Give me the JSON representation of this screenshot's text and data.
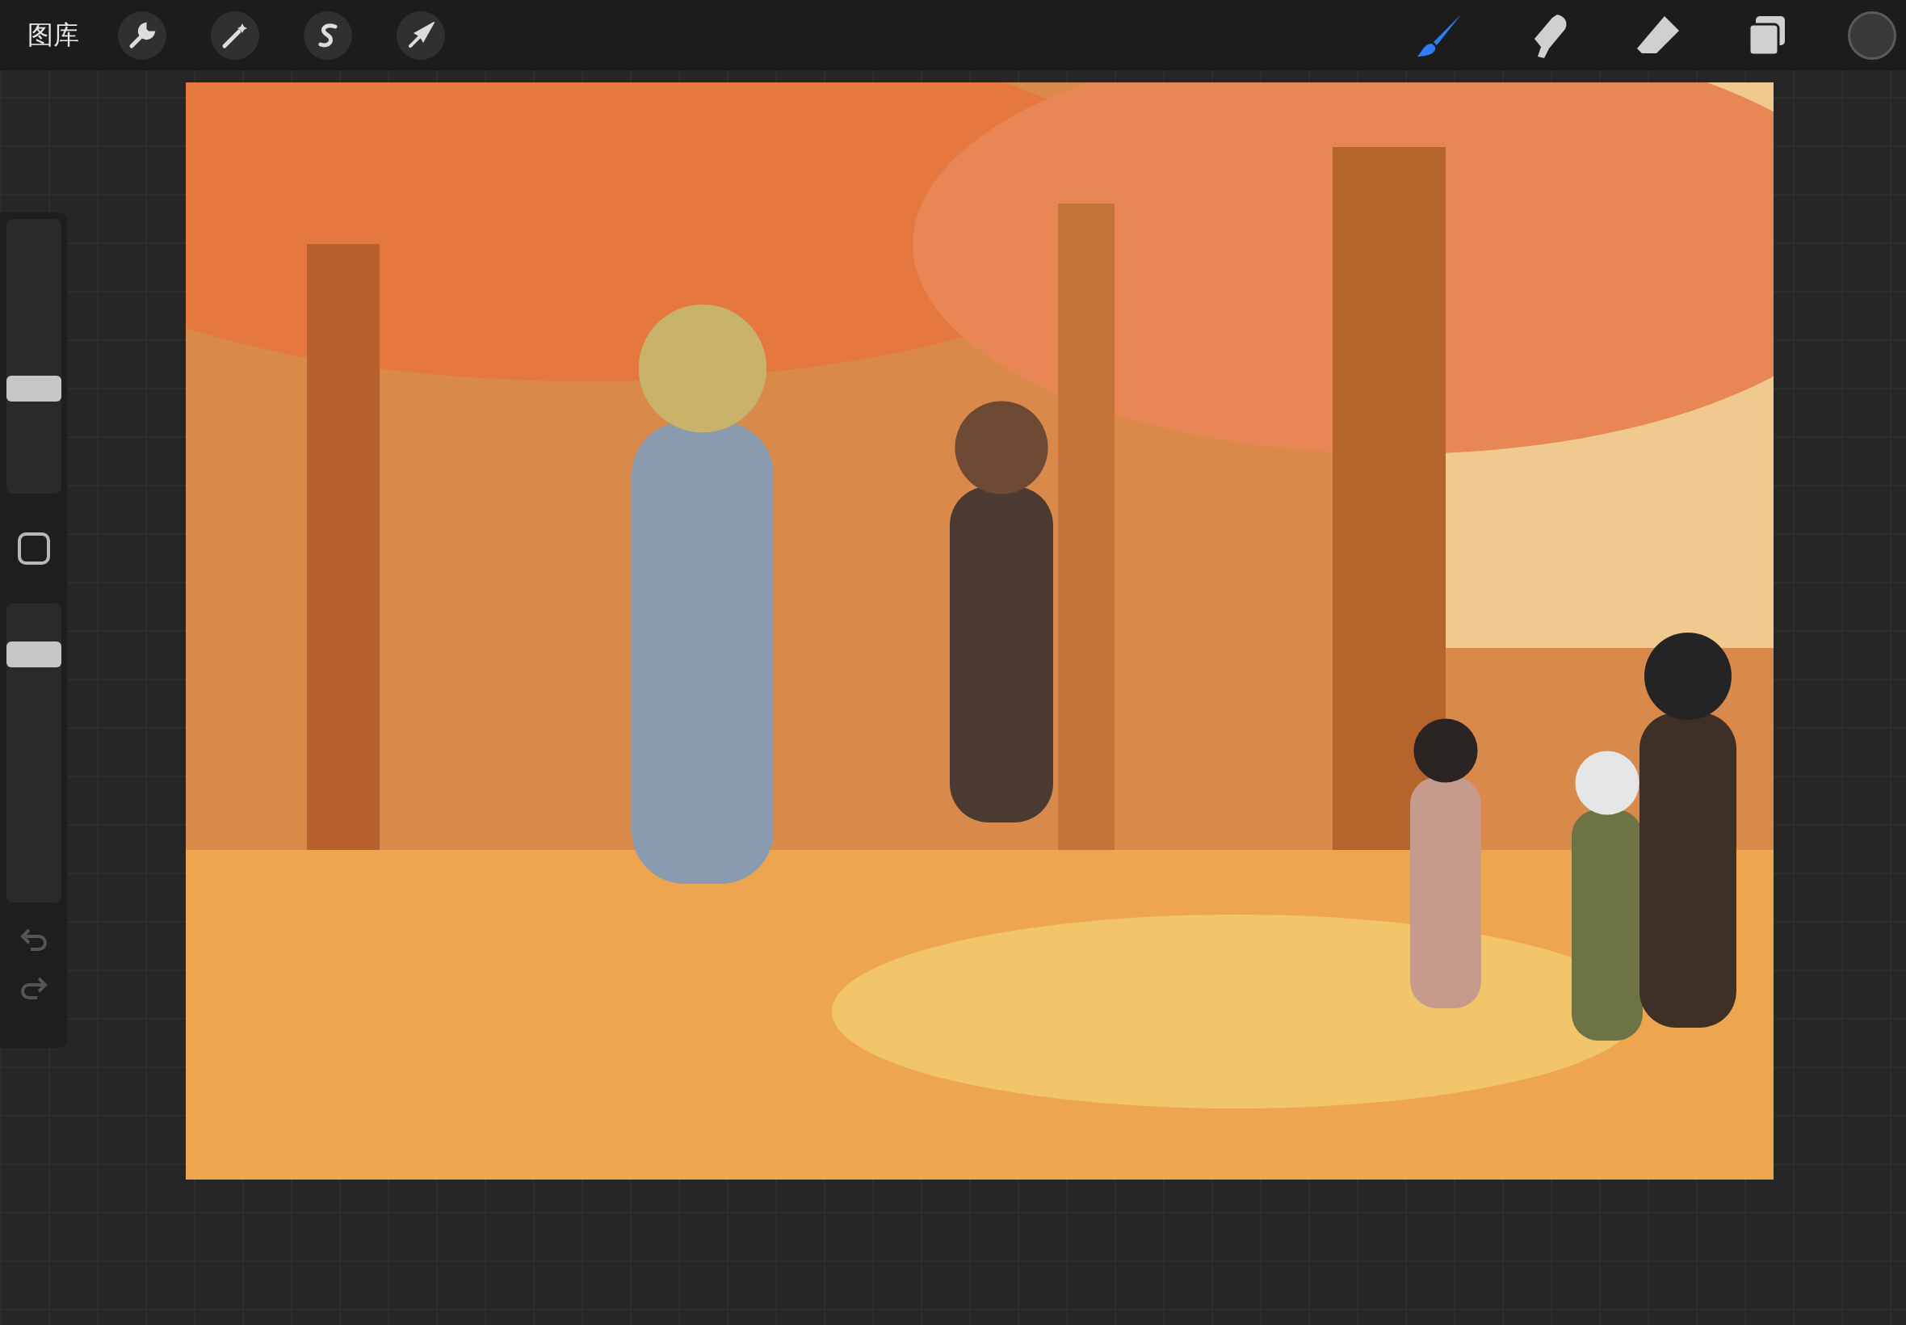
{
  "top_bar": {
    "gallery_label": "图库",
    "tools": [
      {
        "kind": "brush",
        "selected": true
      },
      {
        "kind": "smudge",
        "selected": false
      },
      {
        "kind": "eraser",
        "selected": false
      },
      {
        "kind": "layers",
        "selected": false
      }
    ]
  },
  "sidebar": {
    "brush_size": {
      "level": 0.37
    },
    "opacity": {
      "level": 0.86
    }
  }
}
